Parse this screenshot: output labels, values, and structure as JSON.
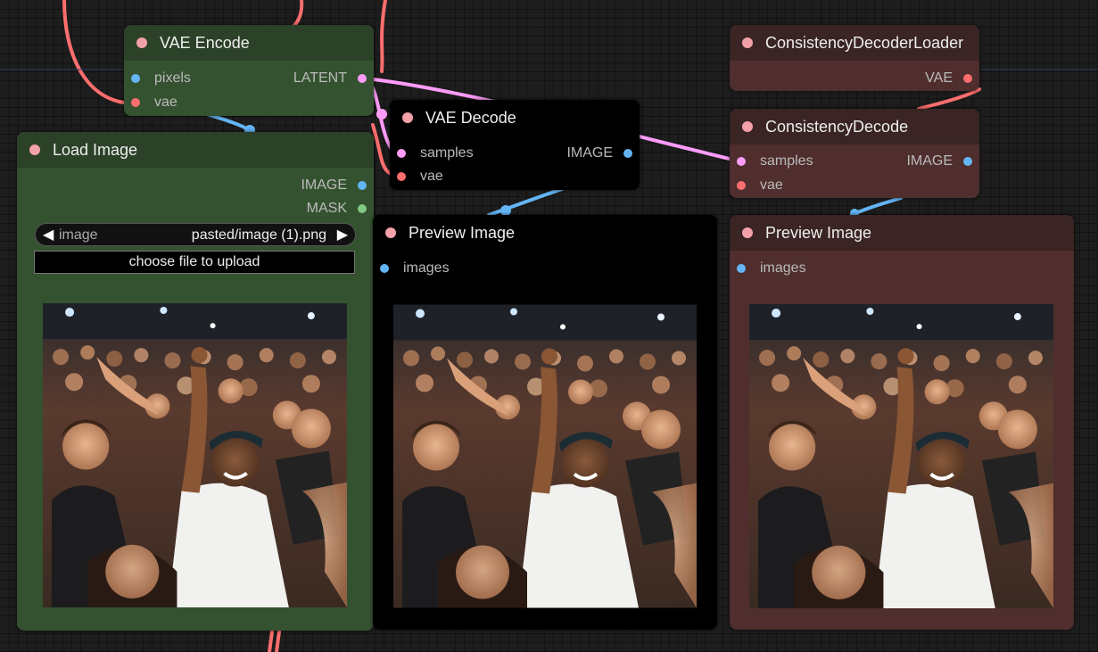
{
  "colors": {
    "green_title": "#2b4228",
    "green_body": "#34522f",
    "black_node": "#000000",
    "brown_title": "#3a2424",
    "brown_body": "#4f2e2d",
    "link_latent": "#ff9cf9",
    "link_image": "#64b5f6",
    "link_vae": "#ff6e6e",
    "status_dot": "#f3a1a9"
  },
  "nodes": {
    "vae_encode": {
      "title": "VAE Encode",
      "inputs": [
        "pixels",
        "vae"
      ],
      "output": "LATENT"
    },
    "vae_decode": {
      "title": "VAE Decode",
      "inputs": [
        "samples",
        "vae"
      ],
      "output": "IMAGE"
    },
    "load_image": {
      "title": "Load Image",
      "outputs": [
        "IMAGE",
        "MASK"
      ],
      "combo_label": "image",
      "combo_value": "pasted/image (1).png",
      "upload_label": "choose file to upload"
    },
    "preview_black": {
      "title": "Preview Image",
      "input": "images"
    },
    "cd_loader": {
      "title": "ConsistencyDecoderLoader",
      "output": "VAE"
    },
    "cd_decode": {
      "title": "ConsistencyDecode",
      "inputs": [
        "samples",
        "vae"
      ],
      "output": "IMAGE"
    },
    "preview_brown": {
      "title": "Preview Image",
      "input": "images"
    }
  },
  "icons": {
    "arrow_left": "◀",
    "arrow_right": "▶"
  }
}
